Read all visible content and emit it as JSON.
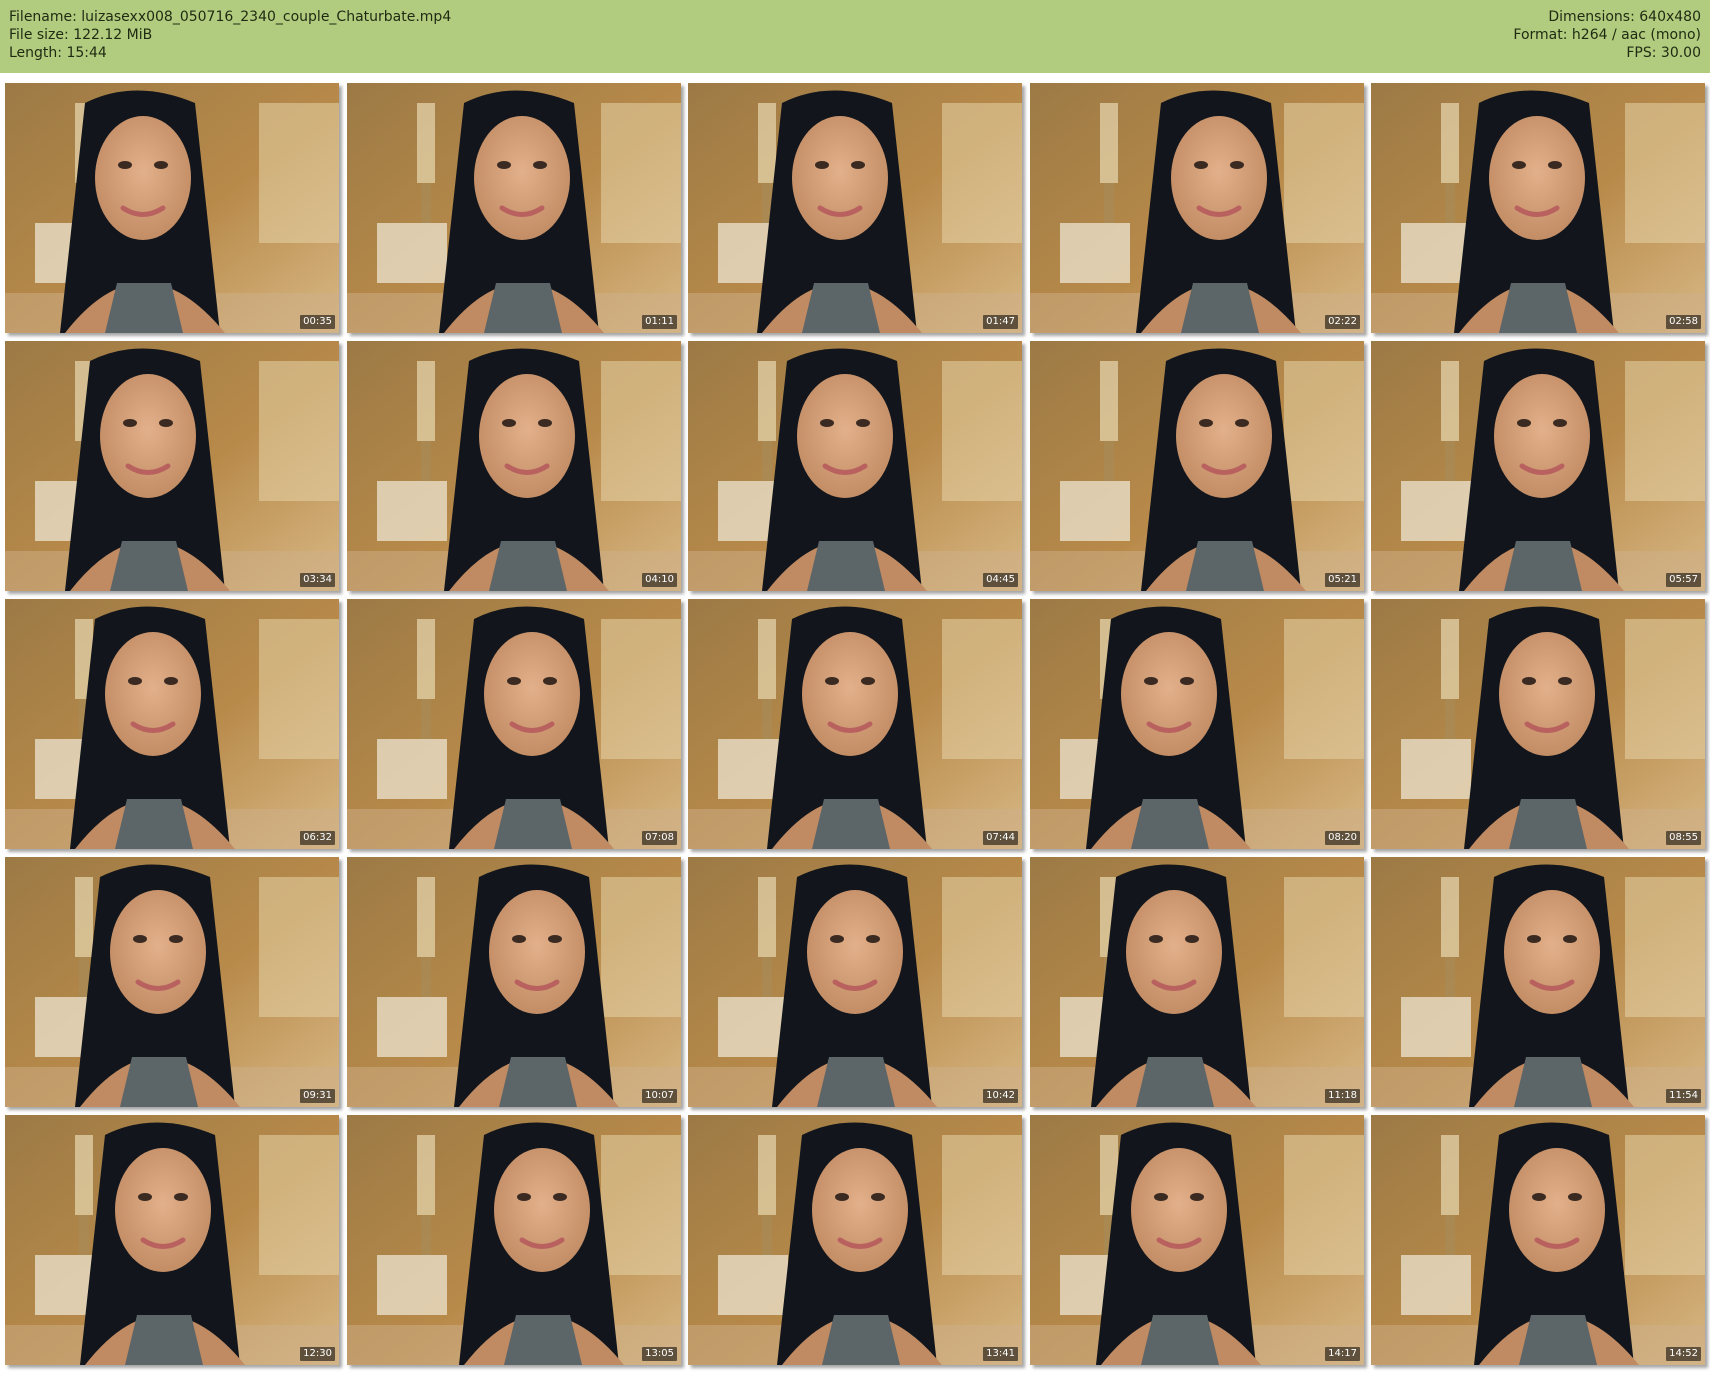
{
  "header": {
    "filename": "Filename: luizasexx008_050716_2340_couple_Chaturbate.mp4",
    "filesize": "File size: 122.12 MiB",
    "length": "Length: 15:44",
    "dimensions": "Dimensions: 640x480",
    "format": "Format: h264 / aac (mono)",
    "fps": "FPS: 30.00"
  },
  "colors": {
    "header_bg": "#b1cc7e",
    "room_warm": "#b88a4a",
    "hair": "#12161c",
    "skin": "#c08a62",
    "top": "#5c6668"
  },
  "thumbnails": [
    {
      "time": "00:35"
    },
    {
      "time": "01:11"
    },
    {
      "time": "01:47"
    },
    {
      "time": "02:22"
    },
    {
      "time": "02:58"
    },
    {
      "time": "03:34"
    },
    {
      "time": "04:10"
    },
    {
      "time": "04:45"
    },
    {
      "time": "05:21"
    },
    {
      "time": "05:57"
    },
    {
      "time": "06:32"
    },
    {
      "time": "07:08"
    },
    {
      "time": "07:44"
    },
    {
      "time": "08:20"
    },
    {
      "time": "08:55"
    },
    {
      "time": "09:31"
    },
    {
      "time": "10:07"
    },
    {
      "time": "10:42"
    },
    {
      "time": "11:18"
    },
    {
      "time": "11:54"
    },
    {
      "time": "12:30"
    },
    {
      "time": "13:05"
    },
    {
      "time": "13:41"
    },
    {
      "time": "14:17"
    },
    {
      "time": "14:52"
    }
  ]
}
